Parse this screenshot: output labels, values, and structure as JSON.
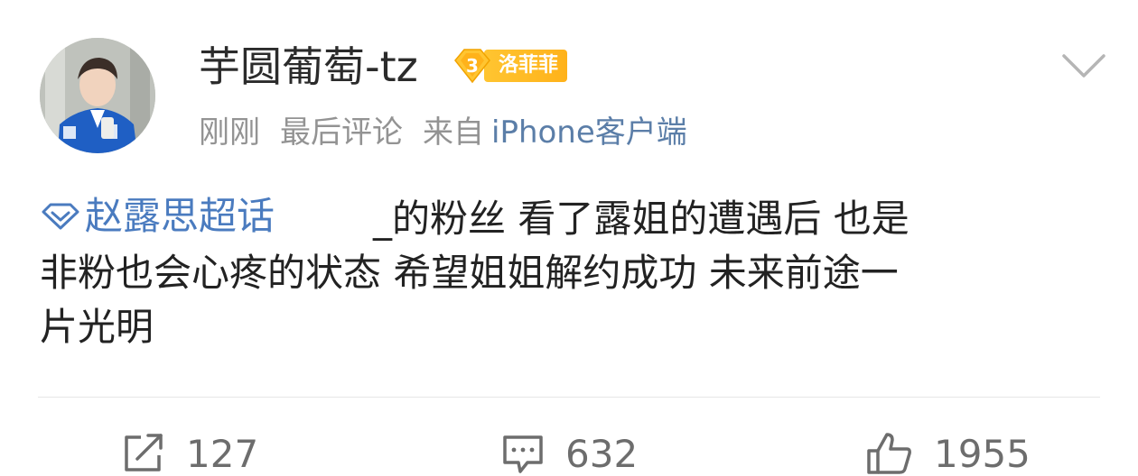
{
  "post": {
    "username": "芋圆葡萄-tz",
    "badge": {
      "level": "3",
      "label": "洛菲菲",
      "color": "#ffb21a"
    },
    "meta": {
      "time": "刚刚",
      "status": "最后评论",
      "source_prefix": "来自",
      "source_app": "iPhone客户端"
    },
    "content": {
      "topic": "赵露思超话",
      "text_line1": "̲的粉丝 看了露姐的遭遇后 也是",
      "text_line2": "非粉也会心疼的状态 希望姐姐解约成功 未来前途一",
      "text_line3": "片光明"
    }
  },
  "actions": {
    "repost_count": "127",
    "comment_count": "632",
    "like_count": "1955"
  },
  "icons": {
    "avatar": "avatar-icon",
    "badge": "level-badge-icon",
    "chevron": "chevron-down-icon",
    "topic": "supertopic-diamond-icon",
    "repost": "repost-icon",
    "comment": "comment-icon",
    "like": "thumbs-up-icon"
  },
  "colors": {
    "link": "#4a7bbf",
    "meta": "#939393",
    "badge": "#ffb21a"
  }
}
